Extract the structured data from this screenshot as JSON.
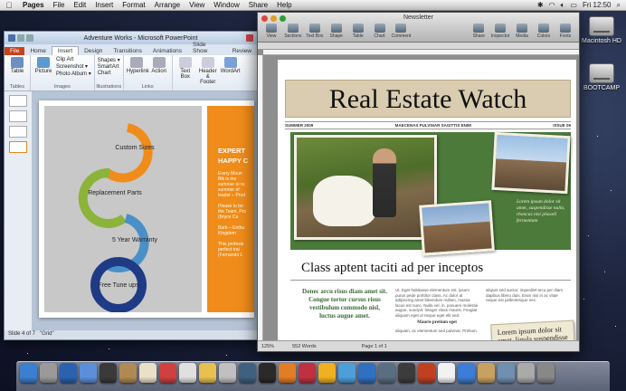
{
  "menubar": {
    "apple": "",
    "app": "Pages",
    "items": [
      "File",
      "Edit",
      "Insert",
      "Format",
      "Arrange",
      "View",
      "Window",
      "Share",
      "Help"
    ],
    "clock": "Fri 12:50"
  },
  "desktop": {
    "icons": [
      {
        "label": "Macintosh HD"
      },
      {
        "label": "BOOTCAMP"
      }
    ]
  },
  "ppt": {
    "title": "Adventure Works - Microsoft PowerPoint",
    "tabs": [
      "File",
      "Home",
      "Insert",
      "Design",
      "Transitions",
      "Animations",
      "Slide Show",
      "Review"
    ],
    "active_tab": "Insert",
    "ribbon": {
      "tables": {
        "btn": "Table",
        "group": "Tables"
      },
      "images": {
        "btn": "Picture",
        "small": [
          "Clip Art",
          "Screenshot ▾",
          "Photo Album ▾"
        ],
        "group": "Images"
      },
      "illustrations": {
        "small": [
          "Shapes ▾",
          "SmartArt",
          "Chart"
        ],
        "group": "Illustrations"
      },
      "links": {
        "btns": [
          "Hyperlink",
          "Action"
        ],
        "group": "Links"
      },
      "text": {
        "btns": [
          "Text Box",
          "Header & Footer",
          "WordArt"
        ],
        "group": "Text"
      }
    },
    "slide": {
      "cycle": [
        "Custom Sizes",
        "Replacement Parts",
        "5 Year Warranty",
        "Free Tune ups"
      ],
      "cycle_colors": [
        "#f08c1a",
        "#8cb33a",
        "#4a90c8",
        "#1f3b86"
      ],
      "heading": "EXPERT HAPPY C",
      "body_lines": [
        "Every Moun",
        "Bik is mo",
        "summer to ru",
        "summer of",
        "leader – Prod",
        "",
        "Please to bo",
        "the Team, Pro",
        "(Bryce Ca",
        "",
        "Barb – Enthu",
        "Kingdom",
        "",
        "This professi",
        "perfect trai",
        "(Fernando L"
      ]
    },
    "status": {
      "slide": "Slide 4 of 7",
      "theme": "\"Grid\""
    }
  },
  "pages": {
    "title": "Newsletter",
    "toolbar": [
      "View",
      "Sections",
      "Text Box",
      "Shape",
      "Table",
      "Chart",
      "Comment",
      "Share",
      "Inspector",
      "Media",
      "Colors",
      "Fonts"
    ],
    "doc": {
      "masthead": "Real Estate Watch",
      "infobar": [
        "SUMMER 2009",
        "MAECENAS PULVINAR SAGITTIS ENIM",
        "ISSUE 09"
      ],
      "caption": "Lorem ipsum dolor sit amet, suspendisse nulla, rhoncus nisi phaseli fermentum",
      "headline": "Class aptent taciti ad per inceptos",
      "pullquote": "Donec arcu risus diam amet sit. Congue tortor cursus risus vestibulum commodo nisl, luctus augue amet.",
      "col2": "Ut. Eget habitasse elementum est, ipsum purus pede porttitor class. Ac dolor at adipiscing amet bibendum nullam, massa lacus est nunc. Nulla vel, in. posuere molestie augue, suscipit. Integer class mauris. Feugiat aliquam eget ut neque eget elit sed.",
      "col2_sub": "Mauris pretium eget",
      "col2_tail": "aliquam, ac elementum sed pulvinar. Pretium",
      "col3": "aliquet sed auctor, imperdiet arcu per diam dapibus libero duis. Enim nisi in ac vitae neque est pellentesque nec.",
      "sticky": "Lorem ipsum dolor sit amet, ligula suspendisse"
    },
    "status": {
      "zoom": "125%",
      "words": "552 Words",
      "page": "Page 1 of 1"
    }
  },
  "dock": {
    "colors": [
      "#3b7fd0",
      "#9a9a9a",
      "#2a62b0",
      "#5b8fd9",
      "#3a3a3a",
      "#b08a52",
      "#e8e0c8",
      "#d04040",
      "#e0e0e0",
      "#e8c050",
      "#c0c0c0",
      "#406080",
      "#2a2a2a",
      "#e27d25",
      "#c03040",
      "#f0b020",
      "#4d9fd9",
      "#3070c0",
      "#5a6e82",
      "#3c3c3c",
      "#c04020",
      "#f2f2f2",
      "#3d7dd6",
      "#c8a060",
      "#7090b0",
      "#aaaaaa",
      "#888888"
    ]
  }
}
